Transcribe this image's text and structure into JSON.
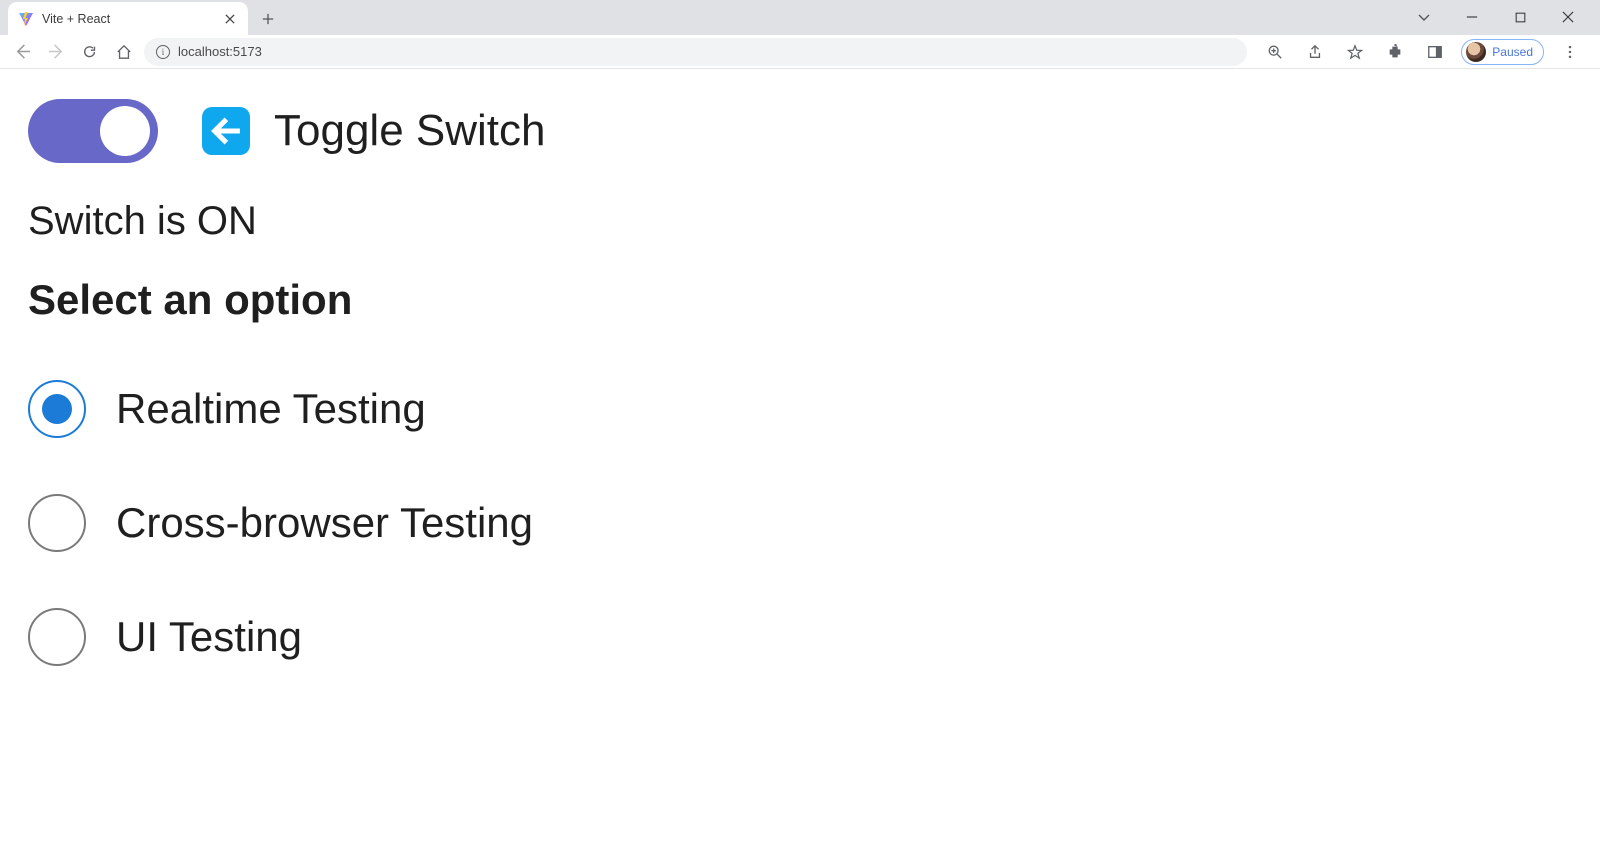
{
  "browser": {
    "tab_title": "Vite + React",
    "url": "localhost:5173",
    "profile_status": "Paused"
  },
  "headline": {
    "title": "Toggle Switch"
  },
  "switch": {
    "status_text": "Switch is ON"
  },
  "section": {
    "heading": "Select an option"
  },
  "options": {
    "0": {
      "label": "Realtime Testing"
    },
    "1": {
      "label": "Cross-browser Testing"
    },
    "2": {
      "label": "UI Testing"
    }
  }
}
